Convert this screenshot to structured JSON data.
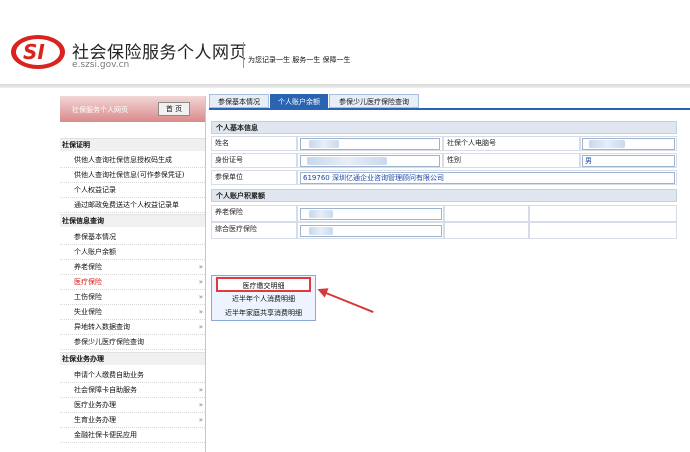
{
  "header": {
    "logo_text": "SI",
    "title": "社会保险服务个人网页",
    "domain": "e.szsi.gov.cn",
    "slogan": "为您记录一生 服务一生 保障一生"
  },
  "sidebar": {
    "title": "社保服务个人网页",
    "home_label": "首 页",
    "sections": [
      {
        "label": "社保证明",
        "items": [
          {
            "label": "供他人查询社保信息授权码生成",
            "has_chevron": false
          },
          {
            "label": "供他人查询社保信息(可作参保凭证)",
            "has_chevron": false
          },
          {
            "label": "个人权益记录",
            "has_chevron": false
          },
          {
            "label": "通过邮政免费送达个人权益记录单",
            "has_chevron": false
          }
        ]
      },
      {
        "label": "社保信息查询",
        "items": [
          {
            "label": "参保基本情况",
            "has_chevron": false
          },
          {
            "label": "个人账户余额",
            "has_chevron": false
          },
          {
            "label": "养老保险",
            "has_chevron": true
          },
          {
            "label": "医疗保险",
            "has_chevron": true,
            "highlighted": true
          },
          {
            "label": "工伤保险",
            "has_chevron": true
          },
          {
            "label": "失业保险",
            "has_chevron": true
          },
          {
            "label": "异地转入数据查询",
            "has_chevron": true
          },
          {
            "label": "参保少儿医疗保险查询",
            "has_chevron": false
          }
        ]
      },
      {
        "label": "社保业务办理",
        "items": [
          {
            "label": "申请个人缴费自助业务",
            "has_chevron": false
          },
          {
            "label": "社会保障卡自助服务",
            "has_chevron": true
          },
          {
            "label": "医疗业务办理",
            "has_chevron": true
          },
          {
            "label": "生育业务办理",
            "has_chevron": true
          },
          {
            "label": "金融社保卡便民应用",
            "has_chevron": false
          }
        ]
      }
    ]
  },
  "tabs": [
    {
      "label": "参保基本情况",
      "active": false
    },
    {
      "label": "个人账户余额",
      "active": true
    },
    {
      "label": "参保少儿医疗保险查询",
      "active": false
    }
  ],
  "basic_info": {
    "title": "个人基本信息",
    "name_label": "姓名",
    "social_id_label": "社保个人电脑号",
    "id_label": "身份证号",
    "gender_label": "性别",
    "gender_value": "男",
    "unit_label": "参保单位",
    "unit_value": "619760  深圳亿通企业咨询管理顾问有限公司"
  },
  "account": {
    "title": "个人账户积累额",
    "rows": [
      {
        "label": "养老保险"
      },
      {
        "label": "综合医疗保险"
      }
    ]
  },
  "dropdown": {
    "items": [
      {
        "label": "医疗缴交明细",
        "boxed": true
      },
      {
        "label": "近半年个人消费明细",
        "boxed": false
      },
      {
        "label": "近半年家庭共享消费明细",
        "boxed": false
      }
    ]
  },
  "colors": {
    "accent": "#2b63b3",
    "annotation_red": "#d43a3a",
    "sidebar_head": "#d98a8a"
  }
}
